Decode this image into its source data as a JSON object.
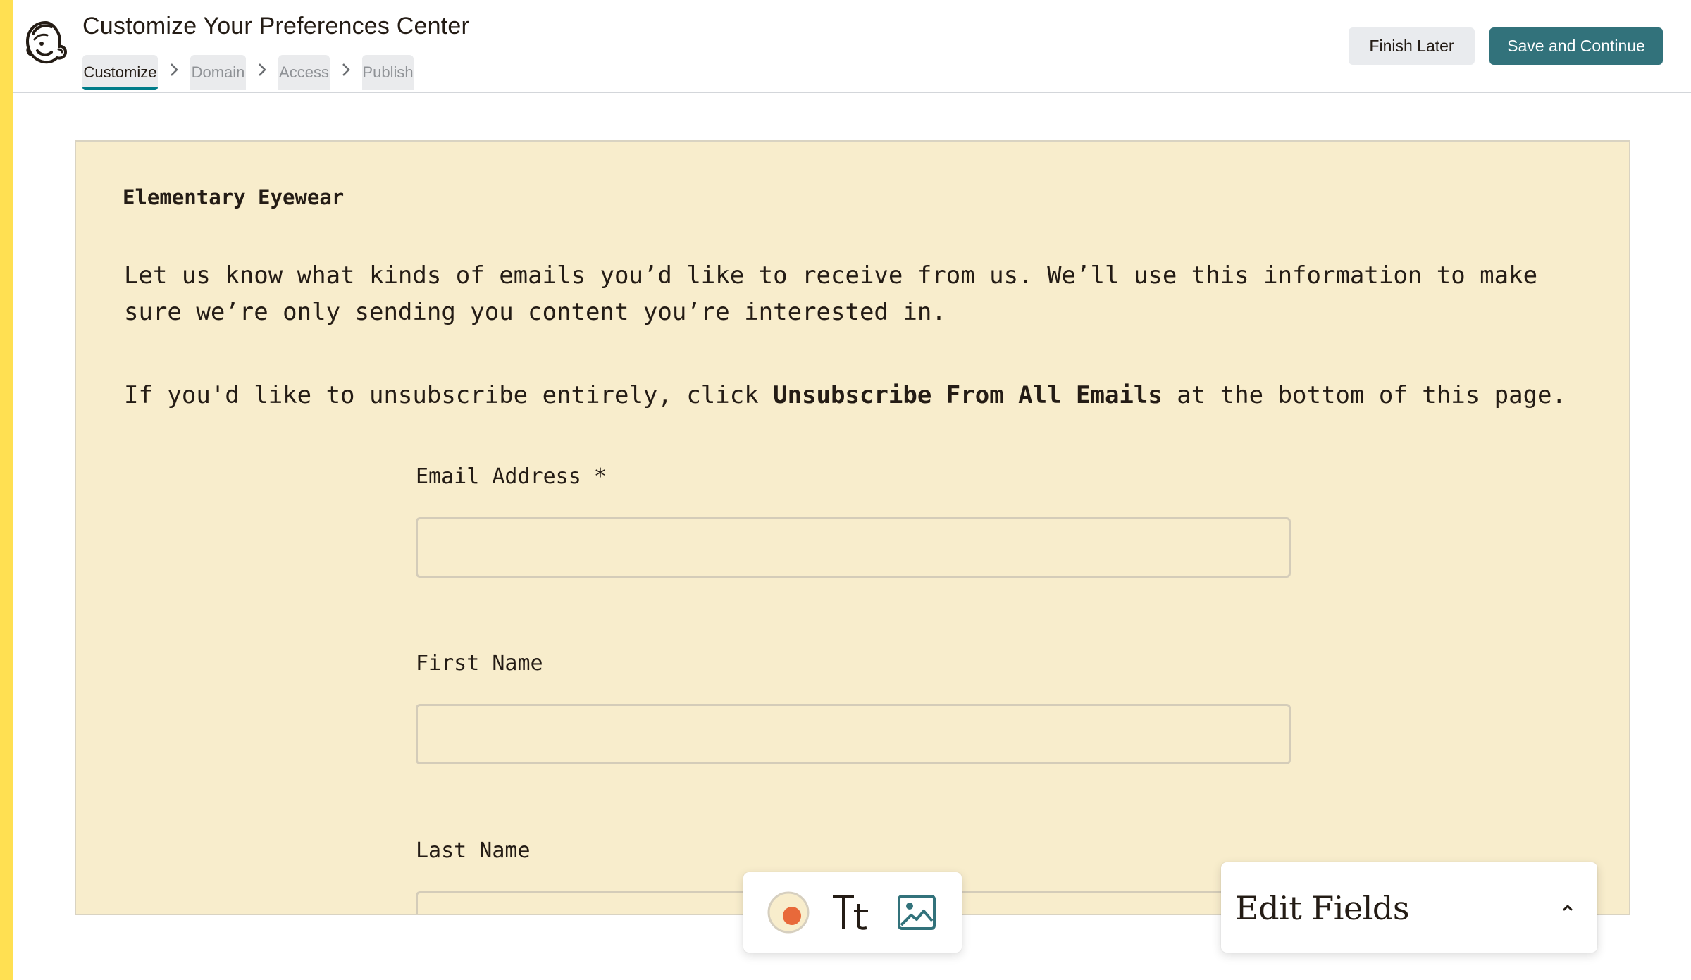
{
  "header": {
    "title": "Customize Your Preferences Center",
    "logo_icon": "mailchimp-freddie-icon",
    "steps": [
      {
        "label": "Customize",
        "active": true
      },
      {
        "label": "Domain",
        "active": false
      },
      {
        "label": "Access",
        "active": false
      },
      {
        "label": "Publish",
        "active": false
      }
    ],
    "finish_later_label": "Finish Later",
    "save_continue_label": "Save and Continue"
  },
  "canvas": {
    "brand_name": "Elementary Eyewear",
    "intro_text": "Let us know what kinds of emails you’d like to receive from us. We’ll use this information to make sure we’re only sending you content you’re interested in.",
    "unsub_prefix": "If you'd like to unsubscribe entirely, click ",
    "unsub_bold": "Unsubscribe From All Emails",
    "unsub_suffix": " at the bottom of this page.",
    "fields": [
      {
        "label": "Email Address *",
        "value": ""
      },
      {
        "label": "First Name",
        "value": ""
      },
      {
        "label": "Last Name",
        "value": ""
      }
    ]
  },
  "toolbar": {
    "tools": [
      "color-palette-icon",
      "text-style-icon",
      "image-icon"
    ]
  },
  "edit_panel": {
    "title": "Edit Fields",
    "chevron": "chevron-up-icon"
  },
  "colors": {
    "accent_stripe": "#ffe052",
    "primary_button": "#32727b",
    "active_step_underline": "#007c89",
    "canvas_background": "#f8edcc",
    "palette_dot": "#e8693a"
  }
}
